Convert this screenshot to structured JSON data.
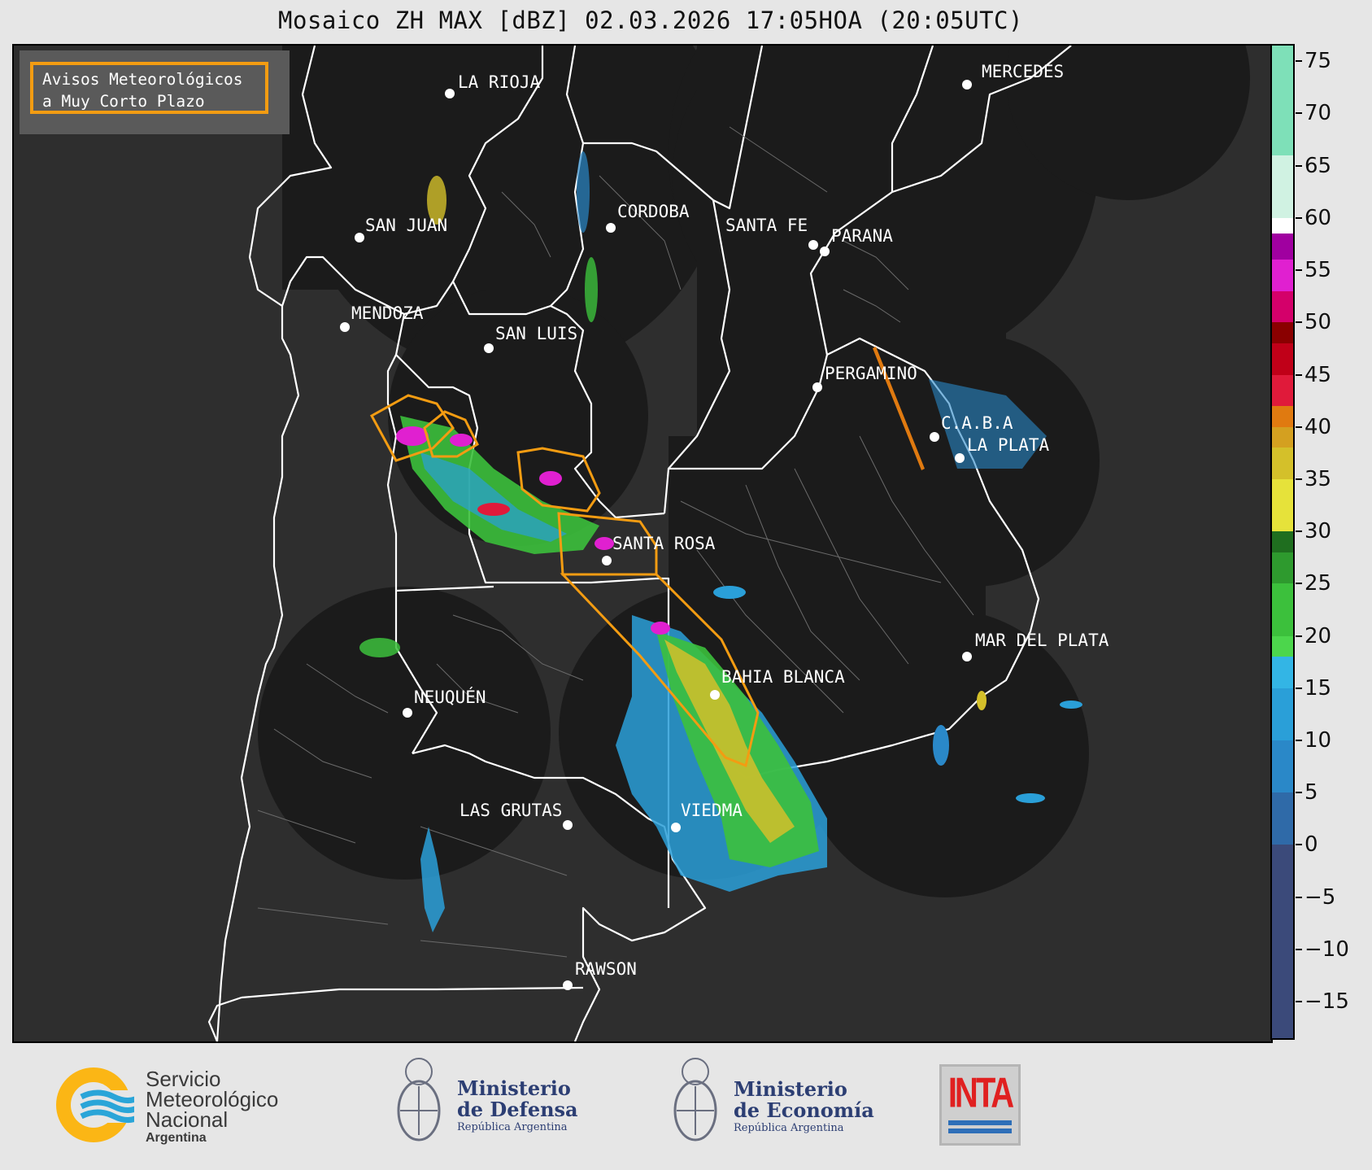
{
  "title": "Mosaico ZH MAX [dBZ] 02.03.2026 17:05HOA (20:05UTC)",
  "legend": {
    "line1": "Avisos Meteorológicos",
    "line2": "a Muy Corto Plazo",
    "border_color": "#f39c12"
  },
  "cities": [
    "LA RIOJA",
    "SAN JUAN",
    "CORDOBA",
    "SANTA FE",
    "PARANA",
    "MERCEDES",
    "MENDOZA",
    "SAN LUIS",
    "PERGAMINO",
    "C.A.B.A",
    "LA PLATA",
    "SANTA ROSA",
    "MAR DEL PLATA",
    "BAHIA BLANCA",
    "NEUQUÉN",
    "LAS GRUTAS",
    "VIEDMA",
    "RAWSON"
  ],
  "colorbar": {
    "unit": "dBZ",
    "ticks": [
      "75",
      "70",
      "65",
      "60",
      "55",
      "50",
      "45",
      "40",
      "35",
      "30",
      "25",
      "20",
      "15",
      "10",
      "5",
      "0",
      "−5",
      "−10",
      "−15"
    ],
    "range": [
      -18.5,
      76.5
    ],
    "stops": [
      {
        "from": -18.5,
        "to": 0,
        "color": "#3b4a7a"
      },
      {
        "from": 0,
        "to": 5,
        "color": "#2f6aa8"
      },
      {
        "from": 5,
        "to": 10,
        "color": "#2a88c8"
      },
      {
        "from": 10,
        "to": 15,
        "color": "#2a9fd8"
      },
      {
        "from": 15,
        "to": 18,
        "color": "#33b5e5"
      },
      {
        "from": 18,
        "to": 20,
        "color": "#4cd64c"
      },
      {
        "from": 20,
        "to": 25,
        "color": "#3cc03c"
      },
      {
        "from": 25,
        "to": 28,
        "color": "#2e9a2e"
      },
      {
        "from": 28,
        "to": 30,
        "color": "#1f6e1f"
      },
      {
        "from": 30,
        "to": 35,
        "color": "#e6e23a"
      },
      {
        "from": 35,
        "to": 38,
        "color": "#d4c02a"
      },
      {
        "from": 38,
        "to": 40,
        "color": "#d4a020"
      },
      {
        "from": 40,
        "to": 42,
        "color": "#e07a10"
      },
      {
        "from": 42,
        "to": 45,
        "color": "#e01a3a"
      },
      {
        "from": 45,
        "to": 48,
        "color": "#c00018"
      },
      {
        "from": 48,
        "to": 50,
        "color": "#8a0000"
      },
      {
        "from": 50,
        "to": 53,
        "color": "#d4006a"
      },
      {
        "from": 53,
        "to": 56,
        "color": "#e020d0"
      },
      {
        "from": 56,
        "to": 58.5,
        "color": "#a000a0"
      },
      {
        "from": 58.5,
        "to": 60,
        "color": "#ffffff"
      },
      {
        "from": 60,
        "to": 66,
        "color": "#d0f2e2"
      },
      {
        "from": 66,
        "to": 76.5,
        "color": "#7ee0b8"
      }
    ]
  },
  "footer": {
    "smn_line1": "Servicio",
    "smn_line2": "Meteorológico",
    "smn_line3": "Nacional",
    "smn_line4": "Argentina",
    "defensa_line1": "Ministerio",
    "defensa_line2": "de Defensa",
    "defensa_line3": "República Argentina",
    "economia_line1": "Ministerio",
    "economia_line2": "de Economía",
    "economia_line3": "República Argentina",
    "inta": "INTA"
  }
}
